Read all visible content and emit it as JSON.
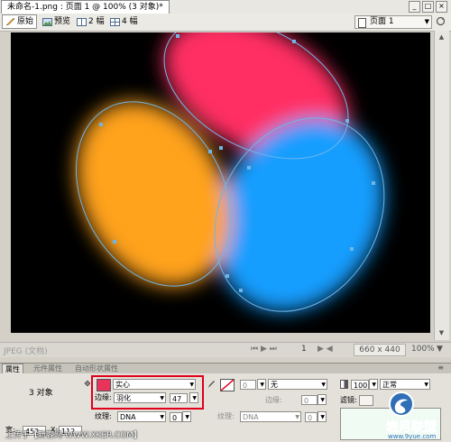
{
  "window": {
    "doc_tab_title": "未命名-1.png : 页面 1 @ 100% (3 对象)*",
    "controls": [
      "_",
      "□",
      "×"
    ]
  },
  "view_toolbar": {
    "original": "原始",
    "preview": "预览",
    "two_up": "2 幅",
    "four_up": "4 幅",
    "page_select": "页面 1"
  },
  "status_bar": {
    "format": "JPEG (文档)",
    "page_number": "1",
    "canvas_size": "660 x 440",
    "zoom": "100%"
  },
  "panel_tabs": [
    "属性",
    "元件属性",
    "自动形状属性"
  ],
  "properties": {
    "object_count": "3 对象",
    "width_label": "宽:",
    "width_value": "452",
    "x_label": "X:",
    "x_value": "112",
    "fill_type": "实心",
    "edge_label": "边缘:",
    "edge_type": "羽化",
    "edge_amount": "47",
    "texture_label": "纹理:",
    "texture_value": "DNA",
    "texture_amount": "0",
    "stroke_size": "0",
    "stroke_type": "无",
    "stroke_edge_label": "边缘:",
    "stroke_edge_value": "0",
    "stroke_texture_label": "纹理:",
    "stroke_texture_value": "DNA",
    "stroke_texture_amount": "0",
    "opacity": "100",
    "blend_mode": "正常",
    "filters_label": "滤镜:"
  },
  "watermark": {
    "bottom_text": "上传于【新客网 WWW.XKER.COM】",
    "logo_text": "岩月联盟",
    "logo_url": "www.9yue.com"
  },
  "colors": {
    "fill_swatch": "#e8335b",
    "pink_ellipse": "#ff2d64",
    "orange_ellipse": "#ffa21a",
    "blue_ellipse": "#149eff",
    "selection_path": "#6fb6e8",
    "highlight_box": "#e0001a"
  }
}
